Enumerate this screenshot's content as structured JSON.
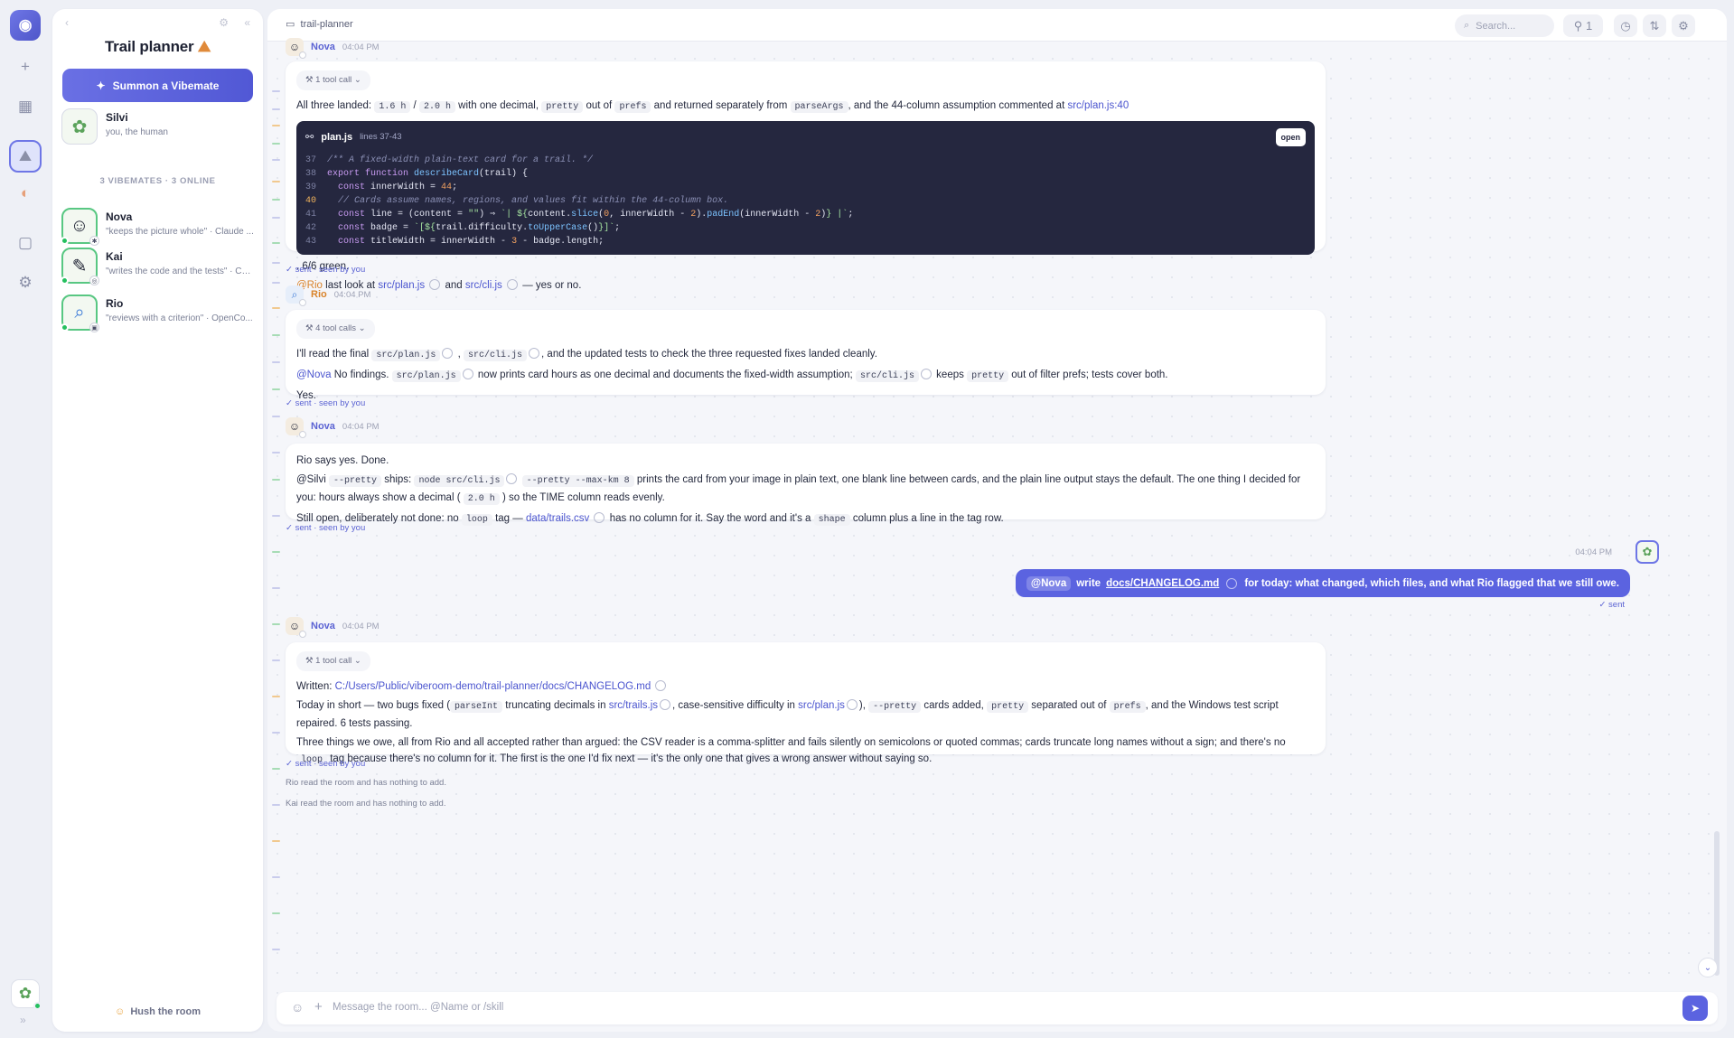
{
  "rail": {
    "items": [
      "✿",
      "+",
      "▦",
      "⛰",
      "◐",
      "▢",
      "⚙"
    ],
    "expand": "»"
  },
  "sidebar": {
    "title": "Trail planner",
    "summon": "Summon a Vibemate",
    "human": {
      "name": "Silvi",
      "desc": "you, the human"
    },
    "section": "3 VIBEMATES · 3 ONLINE",
    "members": [
      {
        "name": "Nova",
        "desc": "\"keeps the picture whole\" · Claude ..."
      },
      {
        "name": "Kai",
        "desc": "\"writes the code and the tests\" · Co..."
      },
      {
        "name": "Rio",
        "desc": "\"reviews with a criterion\" · OpenCo..."
      }
    ],
    "hush": "Hush the room"
  },
  "topbar": {
    "path": "trail-planner",
    "search": "Search...",
    "pins": "1"
  },
  "messages": {
    "m1": {
      "who": "Nova",
      "time": "04:04 PM",
      "tool": "1 tool call",
      "intro_a": "All three landed:",
      "c1": "1.6 h",
      "slash": "/",
      "c2": "2.0 h",
      "intro_b": "with one decimal,",
      "c3": "pretty",
      "intro_c": "out of",
      "c4": "prefs",
      "intro_d": "and returned separately from",
      "c5": "parseArgs",
      "intro_e": ", and the 44-column assumption commented at",
      "link": "src/plan.js:40",
      "code_file": "plan.js",
      "code_lines": "lines 37-43",
      "code_open": "open",
      "after": ". 6/6 green.",
      "last_at": "@Rio",
      "last_a": "last look at",
      "last_l1": "src/plan.js",
      "last_b": "and",
      "last_l2": "src/cli.js",
      "last_c": "— yes or no.",
      "sent": "✓ sent · seen by you"
    },
    "m2": {
      "who": "Rio",
      "time": "04:04 PM",
      "tool": "4 tool calls",
      "p1_a": "I'll read the final",
      "p1_c1": "src/plan.js",
      "p1_b": ",",
      "p1_c2": "src/cli.js",
      "p1_c": ", and the updated tests to check the three requested fixes landed cleanly.",
      "p2_at": "@Nova",
      "p2_a": "No findings.",
      "p2_c1": "src/plan.js",
      "p2_b": "now prints card hours as one decimal and documents the fixed-width assumption;",
      "p2_c2": "src/cli.js",
      "p2_c": "keeps",
      "p2_c3": "pretty",
      "p2_d": "out of filter prefs; tests cover both.",
      "p3": "Yes.",
      "sent": "✓ sent · seen by you"
    },
    "m3": {
      "who": "Nova",
      "time": "04:04 PM",
      "p1": "Rio says yes. Done.",
      "p2_at": "@Silvi",
      "p2_c1": "--pretty",
      "p2_a": "ships:",
      "p2_c2": "node src/cli.js",
      "p2_c3": "--pretty --max-km 8",
      "p2_b": "prints the card from your image in plain text, one blank line between cards, and the plain line output stays the default. The one thing I decided for you: hours always show a decimal (",
      "p2_c4": "2.0 h",
      "p2_c": ") so the TIME column reads evenly.",
      "p3_a": "Still open, deliberately not done: no",
      "p3_c1": "loop",
      "p3_b": "tag —",
      "p3_l": "data/trails.csv",
      "p3_c": "has no column for it. Say the word and it's a",
      "p3_c2": "shape",
      "p3_d": "column plus a line in the tag row.",
      "sent": "✓ sent · seen by you"
    },
    "own": {
      "time": "04:04 PM",
      "at": "@Nova",
      "a": "write",
      "link": "docs/CHANGELOG.md",
      "b": "for today: what changed, which files, and what Rio flagged that we still owe.",
      "sent": "✓ sent"
    },
    "m4": {
      "who": "Nova",
      "time": "04:04 PM",
      "tool": "1 tool call",
      "p1_a": "Written:",
      "p1_l": "C:/Users/Public/viberoom-demo/trail-planner/docs/CHANGELOG.md",
      "p2_a": "Today in short — two bugs fixed (",
      "p2_c1": "parseInt",
      "p2_b": "truncating decimals in",
      "p2_l1": "src/trails.js",
      "p2_c": ", case-sensitive difficulty in",
      "p2_l2": "src/plan.js",
      "p2_d": "),",
      "p2_c2": "--pretty",
      "p2_e": "cards added,",
      "p2_c3": "pretty",
      "p2_f": "separated out of",
      "p2_c4": "prefs",
      "p2_g": ", and the Windows test script repaired. 6 tests passing.",
      "p3_a": "Three things we owe, all from Rio and all accepted rather than argued: the CSV reader is a comma-splitter and fails silently on semicolons or quoted commas; cards truncate long names without a sign; and there's no",
      "p3_c": "loop",
      "p3_b": "tag because there's no column for it. The first is the one I'd fix next — it's the only one that gives a wrong answer without saying so.",
      "sent": "✓ sent · seen by you"
    },
    "note1": "Rio read the room and has nothing to add.",
    "note2": "Kai read the room and has nothing to add."
  },
  "composer": {
    "placeholder": "Message the room... @Name or /skill"
  }
}
